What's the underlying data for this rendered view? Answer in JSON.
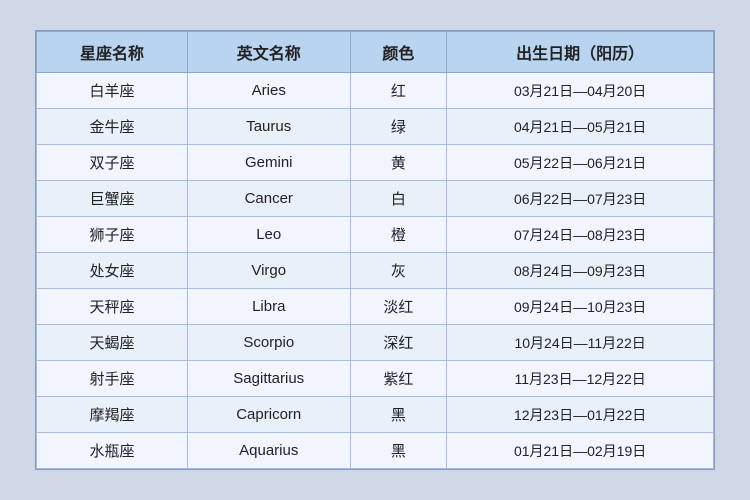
{
  "table": {
    "headers": [
      "星座名称",
      "英文名称",
      "颜色",
      "出生日期（阳历）"
    ],
    "rows": [
      {
        "chinese": "白羊座",
        "english": "Aries",
        "color": "红",
        "dates": "03月21日—04月20日"
      },
      {
        "chinese": "金牛座",
        "english": "Taurus",
        "color": "绿",
        "dates": "04月21日—05月21日"
      },
      {
        "chinese": "双子座",
        "english": "Gemini",
        "color": "黄",
        "dates": "05月22日—06月21日"
      },
      {
        "chinese": "巨蟹座",
        "english": "Cancer",
        "color": "白",
        "dates": "06月22日—07月23日"
      },
      {
        "chinese": "狮子座",
        "english": "Leo",
        "color": "橙",
        "dates": "07月24日—08月23日"
      },
      {
        "chinese": "处女座",
        "english": "Virgo",
        "color": "灰",
        "dates": "08月24日—09月23日"
      },
      {
        "chinese": "天秤座",
        "english": "Libra",
        "color": "淡红",
        "dates": "09月24日—10月23日"
      },
      {
        "chinese": "天蝎座",
        "english": "Scorpio",
        "color": "深红",
        "dates": "10月24日—11月22日"
      },
      {
        "chinese": "射手座",
        "english": "Sagittarius",
        "color": "紫红",
        "dates": "11月23日—12月22日"
      },
      {
        "chinese": "摩羯座",
        "english": "Capricorn",
        "color": "黑",
        "dates": "12月23日—01月22日"
      },
      {
        "chinese": "水瓶座",
        "english": "Aquarius",
        "color": "黑",
        "dates": "01月21日—02月19日"
      }
    ]
  }
}
